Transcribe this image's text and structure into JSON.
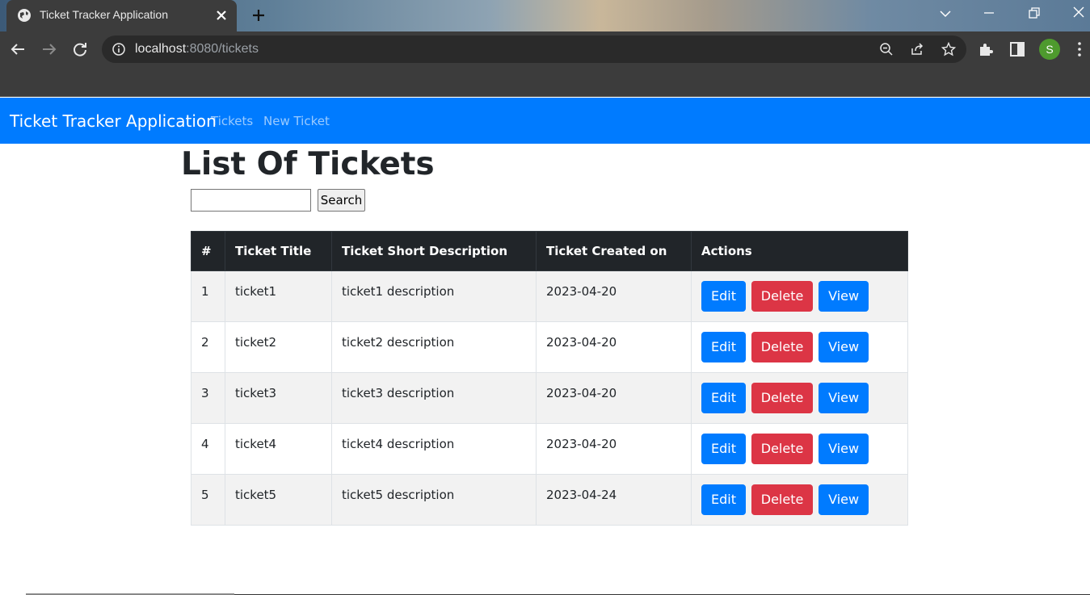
{
  "browser": {
    "tab_title": "Ticket Tracker Application",
    "url_host": "localhost",
    "url_rest": ":8080/tickets",
    "profile_initial": "S"
  },
  "navbar": {
    "brand": "Ticket Tracker Application",
    "links": [
      "Tickets",
      "New Ticket"
    ]
  },
  "page": {
    "title": "List Of Tickets",
    "search_value": "",
    "search_button": "Search"
  },
  "table": {
    "headers": [
      "#",
      "Ticket Title",
      "Ticket Short Description",
      "Ticket Created on",
      "Actions"
    ],
    "rows": [
      {
        "id": "1",
        "title": "ticket1",
        "description": "ticket1 description",
        "created": "2023-04-20"
      },
      {
        "id": "2",
        "title": "ticket2",
        "description": "ticket2 description",
        "created": "2023-04-20"
      },
      {
        "id": "3",
        "title": "ticket3",
        "description": "ticket3 description",
        "created": "2023-04-20"
      },
      {
        "id": "4",
        "title": "ticket4",
        "description": "ticket4 description",
        "created": "2023-04-20"
      },
      {
        "id": "5",
        "title": "ticket5",
        "description": "ticket5 description",
        "created": "2023-04-24"
      }
    ],
    "actions": {
      "edit": "Edit",
      "delete": "Delete",
      "view": "View"
    }
  },
  "colors": {
    "primary": "#007bff",
    "danger": "#dc3545",
    "table_header": "#212529"
  },
  "icons": [
    "globe-icon",
    "close-icon",
    "plus-icon",
    "chevron-down-icon",
    "minimize-icon",
    "restore-icon",
    "window-close-icon",
    "back-icon",
    "forward-icon",
    "reload-icon",
    "info-icon",
    "zoom-out-icon",
    "share-icon",
    "star-icon",
    "extensions-icon",
    "side-panel-icon",
    "menu-icon"
  ]
}
